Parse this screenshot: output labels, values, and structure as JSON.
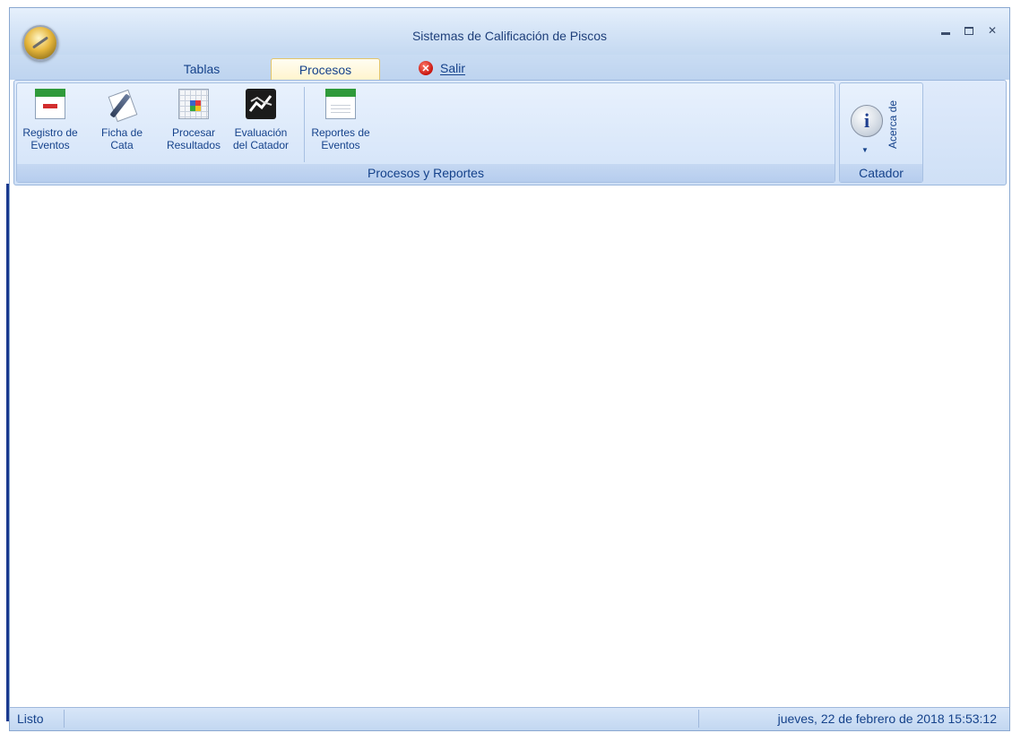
{
  "window": {
    "title": "Sistemas de Calificación de Piscos"
  },
  "tabs": [
    {
      "label": "Tablas",
      "active": false
    },
    {
      "label": "Procesos",
      "active": true
    }
  ],
  "salir": {
    "label": "Salir",
    "icon": "close-circle-icon"
  },
  "ribbon": {
    "groups": [
      {
        "caption": "Procesos y Reportes",
        "buttons": [
          {
            "line1": "Registro de",
            "line2": "Eventos",
            "icon": "calendar-icon"
          },
          {
            "line1": "Ficha de",
            "line2": "Cata",
            "icon": "pen-paper-icon"
          },
          {
            "line1": "Procesar",
            "line2": "Resultados",
            "icon": "grid-table-icon"
          },
          {
            "line1": "Evaluación",
            "line2": "del Catador",
            "icon": "line-chart-icon"
          },
          {
            "line1": "Reportes de",
            "line2": "Eventos",
            "icon": "calendar-report-icon"
          }
        ]
      },
      {
        "caption": "Catador",
        "buttons": [
          {
            "label": "Acerca de",
            "icon": "info-icon"
          }
        ]
      }
    ]
  },
  "status": {
    "left": "Listo",
    "right": "jueves, 22 de febrero de 2018 15:53:12"
  },
  "colors": {
    "ribbon_text": "#15428b",
    "active_tab": "#fff4cc",
    "ribbon_bg": "#d3e3f8"
  }
}
